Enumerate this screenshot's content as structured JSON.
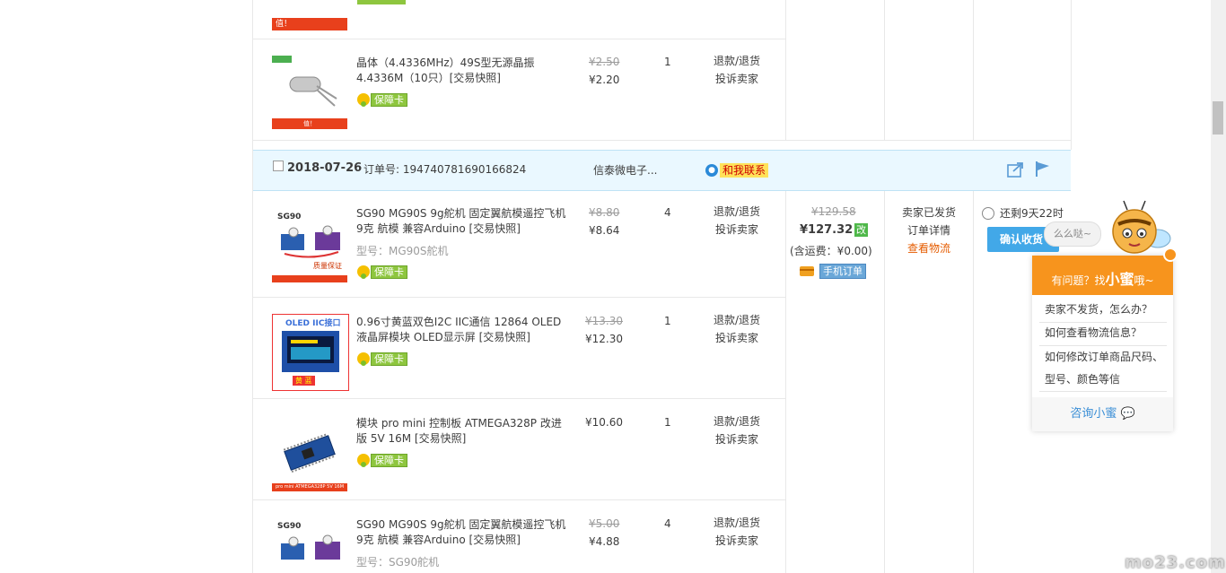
{
  "colors": {
    "accent_blue": "#42a8e8",
    "header_bg": "#eaf8ff",
    "orange": "#f7941d",
    "link_orange": "#e55c00",
    "badge_green": "#8ec63f"
  },
  "prev_order": {
    "top_banner_text": "值！",
    "item": {
      "title": "晶体（4.4336MHz）49S型无源晶振4.4336M（10只）[交易快照]",
      "badge": "保障卡",
      "old_price": "¥2.50",
      "price": "¥2.20",
      "qty": "1",
      "action1": "退款/退货",
      "action2": "投诉卖家",
      "thumb_banner": "值！"
    }
  },
  "order": {
    "date": "2018-07-26",
    "order_no_label": "订单号: 194740781690166824",
    "shop": "信泰微电子...",
    "chat_label": "和我联系",
    "total_old": "¥129.58",
    "total_new": "¥127.32",
    "edit_tag": "改",
    "shipping": "(含运费：¥0.00)",
    "mobile_tag": "手机订单",
    "status": "卖家已发货",
    "detail_link": "订单详情",
    "logistics_link": "查看物流",
    "remaining": "还剩9天22时",
    "confirm_button": "确认收货",
    "items": [
      {
        "title": "SG90 MG90S 9g舵机 固定翼航模遥控飞机 9克 航模 兼容Arduino [交易快照]",
        "spec": "型号：MG90S舵机",
        "badge": "保障卡",
        "old_price": "¥8.80",
        "price": "¥8.64",
        "qty": "4",
        "action1": "退款/退货",
        "action2": "投诉卖家",
        "thumb_label": "SG90",
        "thumb_tag": "质量保证"
      },
      {
        "title": "0.96寸黄蓝双色I2C IIC通信 12864 OLED液晶屏模块 OLED显示屏 [交易快照]",
        "spec": "",
        "badge": "保障卡",
        "old_price": "¥13.30",
        "price": "¥12.30",
        "qty": "1",
        "action1": "退款/退货",
        "action2": "投诉卖家",
        "thumb_label": "OLED IIC接口",
        "thumb_tag": "黄 蓝"
      },
      {
        "title": "模块 pro mini 控制板 ATMEGA328P 改进版 5V 16M [交易快照]",
        "spec": "",
        "badge": "保障卡",
        "old_price": "",
        "price": "¥10.60",
        "qty": "1",
        "action1": "退款/退货",
        "action2": "投诉卖家",
        "thumb_label": "",
        "thumb_tag": "pro mini ATMEGA328P 5V 16M"
      },
      {
        "title": "SG90 MG90S 9g舵机 固定翼航模遥控飞机 9克 航模 兼容Arduino [交易快照]",
        "spec": "型号：SG90舵机",
        "badge": "",
        "old_price": "¥5.00",
        "price": "¥4.88",
        "qty": "4",
        "action1": "退款/退货",
        "action2": "投诉卖家",
        "thumb_label": "SG90",
        "thumb_tag": ""
      }
    ]
  },
  "widget": {
    "bubble": "么么哒~",
    "head_prefix": "有问题？找",
    "head_name": "小蜜",
    "head_suffix": "哦~",
    "questions": [
      "卖家不发货，怎么办？",
      "如何查看物流信息？",
      "如何修改订单商品尺码、型号、颜色等信"
    ],
    "consult": "咨询小蜜"
  },
  "watermark": "mo23.com"
}
